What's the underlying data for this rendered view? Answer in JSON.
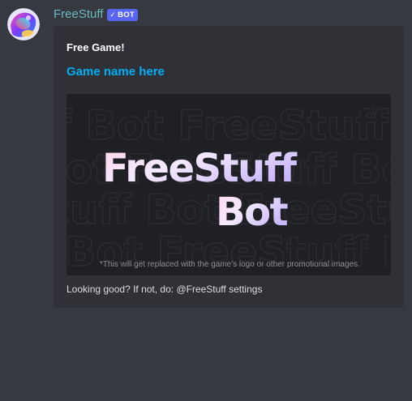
{
  "message": {
    "username": "FreeStuff",
    "bot_tag": "BOT",
    "bot_check": "✓"
  },
  "embed": {
    "title": "Free Game!",
    "link_text": "Game name here",
    "image": {
      "logo_line1": "FreeStuff",
      "logo_line2": "Bot",
      "caption": "*This will get replaced with the game's logo or other promotional images"
    },
    "footer": "Looking good? If not, do: @FreeStuff settings"
  },
  "colors": {
    "background": "#36393f",
    "embed_bg": "#2f3136",
    "username": "#6bb9c0",
    "bot_tag": "#5865f2",
    "link": "#00aff4"
  }
}
